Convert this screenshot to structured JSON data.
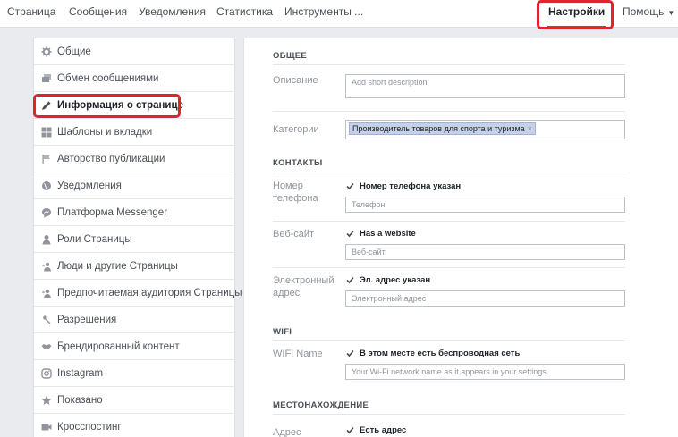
{
  "nav": {
    "tabs": [
      "Страница",
      "Сообщения",
      "Уведомления",
      "Статистика",
      "Инструменты ..."
    ],
    "active": "Настройки",
    "help": "Помощь"
  },
  "sidebar": {
    "items": [
      {
        "label": "Общие",
        "icon": "gear-icon"
      },
      {
        "label": "Обмен сообщениями",
        "icon": "messages-icon"
      },
      {
        "label": "Информация о странице",
        "icon": "pencil-icon",
        "active": true
      },
      {
        "label": "Шаблоны и вкладки",
        "icon": "grid-icon"
      },
      {
        "label": "Авторство публикации",
        "icon": "flag-icon"
      },
      {
        "label": "Уведомления",
        "icon": "globe-icon"
      },
      {
        "label": "Платформа Messenger",
        "icon": "messenger-icon"
      },
      {
        "label": "Роли Страницы",
        "icon": "person-icon"
      },
      {
        "label": "Люди и другие Страницы",
        "icon": "people-icon"
      },
      {
        "label": "Предпочитаемая аудитория Страницы",
        "icon": "audience-icon"
      },
      {
        "label": "Разрешения",
        "icon": "wrench-icon"
      },
      {
        "label": "Брендированный контент",
        "icon": "handshake-icon"
      },
      {
        "label": "Instagram",
        "icon": "instagram-icon"
      },
      {
        "label": "Показано",
        "icon": "star-icon"
      },
      {
        "label": "Кросспостинг",
        "icon": "video-icon"
      }
    ]
  },
  "form": {
    "general_title": "ОБЩЕЕ",
    "description_label": "Описание",
    "description_placeholder": "Add short description",
    "categories_label": "Категории",
    "category_tag": "Производитель товаров для спорта и туризма",
    "contacts_title": "КОНТАКТЫ",
    "phone_label_1": "Номер",
    "phone_label_2": "телефона",
    "phone_check": "Номер телефона указан",
    "phone_placeholder": "Телефон",
    "website_label": "Веб-сайт",
    "website_check": "Has a website",
    "website_placeholder": "Веб-сайт",
    "email_label_1": "Электронный",
    "email_label_2": "адрес",
    "email_check": "Эл. адрес указан",
    "email_placeholder": "Электронный адрес",
    "wifi_title": "WIFI",
    "wifi_label": "WIFI Name",
    "wifi_check": "В этом месте есть беспроводная сеть",
    "wifi_placeholder": "Your Wi-Fi network name as it appears in your settings",
    "location_title": "МЕСТОНАХОЖДЕНИЕ",
    "address_label": "Адрес",
    "address_check": "Есть адрес"
  },
  "colors": {
    "highlight": "#e0242c",
    "accent": "#4267b2"
  }
}
